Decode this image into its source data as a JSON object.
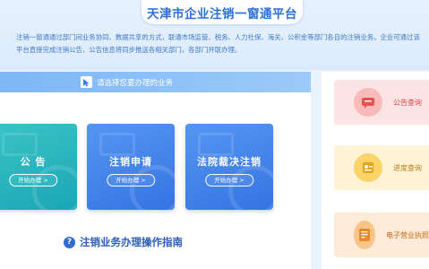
{
  "header": {
    "title": "天津市企业注销一窗通平台",
    "intro": "注销一窗通通过部门间业务协同、数据共享的方式，联通市场监管、税务、人力社保、海关、公积金等部门各自的注销业务。企业可通过该平台直接完成注销公告，公告信息将同步推送各相关部门，各部门并联办理。"
  },
  "services": {
    "prompt": "请选择您要办理的业务",
    "cards": [
      {
        "title": "公  告",
        "button": "开始办理 >"
      },
      {
        "title": "注销申请",
        "button": "开始办理 >"
      },
      {
        "title": "法院裁决注销",
        "button": "开始办理 >"
      }
    ]
  },
  "guide": {
    "label": "注销业务办理操作指南"
  },
  "sidebar": {
    "items": [
      {
        "label": "公告查询",
        "icon": "announcement-icon"
      },
      {
        "label": "进度查询",
        "icon": "progress-icon"
      },
      {
        "label": "电子营业执照",
        "icon": "license-icon"
      }
    ]
  },
  "colors": {
    "title": "#2b6fd6",
    "card_teal": "#1aa6b5",
    "card_blue": "#3574e2",
    "choose_bar": "#7db7f6"
  }
}
